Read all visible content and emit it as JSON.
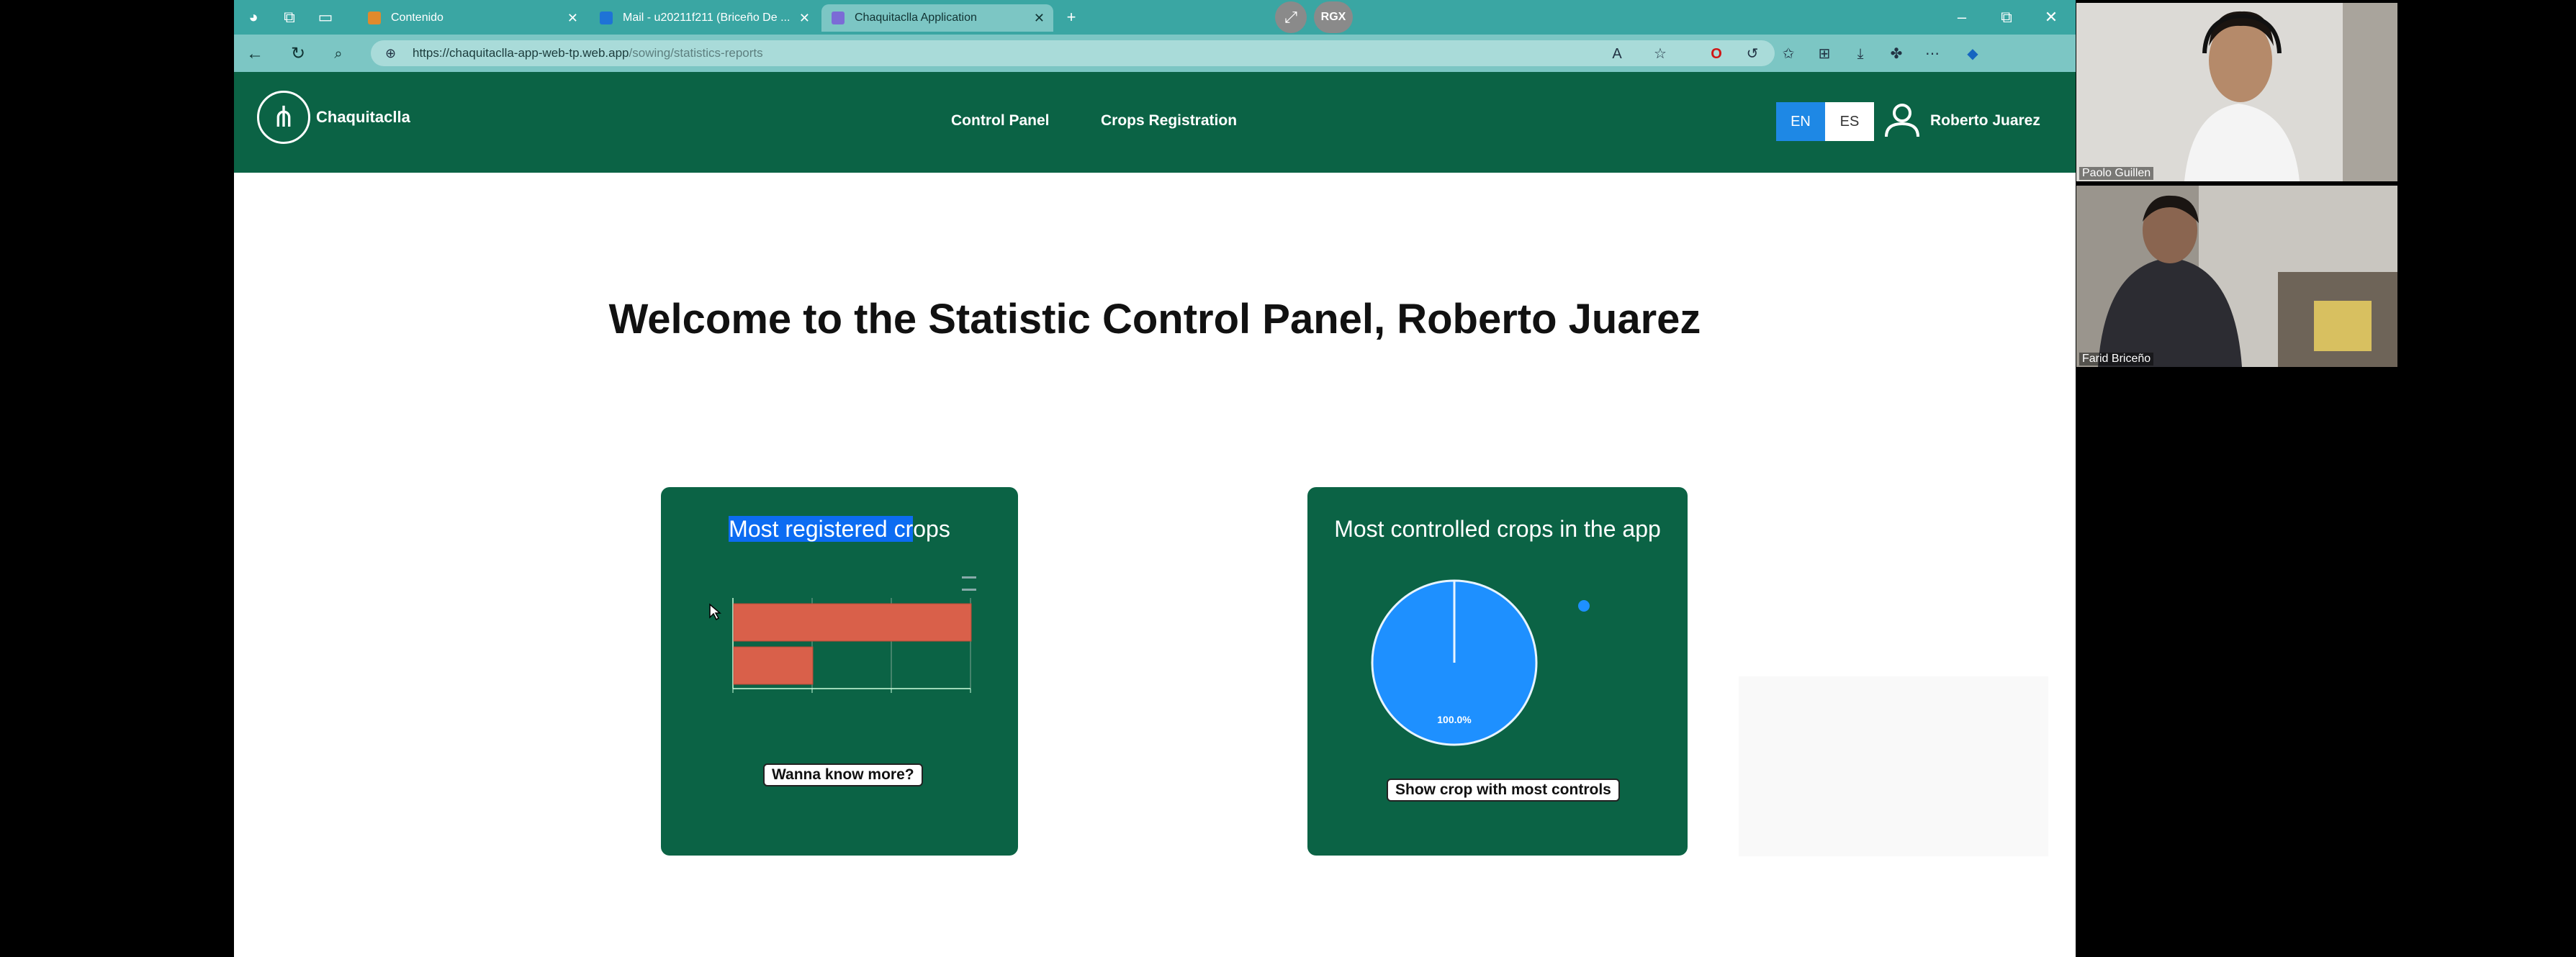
{
  "browser": {
    "tabs": [
      {
        "title": "Contenido",
        "favicon_color": "#e08a2c"
      },
      {
        "title": "Mail - u20211f211 (Briceño De ...",
        "favicon_color": "#1e73d6"
      },
      {
        "title": "Chaquitaclla Application",
        "favicon_color": "#7b6bd6"
      }
    ],
    "url_host": "https://chaquitaclla-app-web-tp.web.app",
    "url_path": "/sowing/statistics-reports",
    "overlay_badge": "RGX"
  },
  "app": {
    "brand": "Chaquitaclla",
    "nav": [
      "Control Panel",
      "Crops Registration"
    ],
    "lang_en": "EN",
    "lang_es": "ES",
    "user": "Roberto Juarez"
  },
  "welcome": "Welcome to the Statistic Control Panel, Roberto Juarez",
  "cards": {
    "registered": {
      "title_selected": "Most registered cr",
      "title_rest": "ops",
      "button": "Wanna know more?"
    },
    "controlled": {
      "title": "Most controlled crops in the app",
      "button": "Show crop with most controls"
    }
  },
  "chart_data": [
    {
      "type": "bar",
      "orientation": "horizontal",
      "title": "Most registered crops",
      "categories": [
        "",
        ""
      ],
      "values": [
        3,
        1
      ],
      "xlim": [
        0,
        3
      ],
      "bar_color": "#d9604a",
      "grid": true
    },
    {
      "type": "pie",
      "title": "Most controlled crops in the app",
      "values": [
        100
      ],
      "data_labels": [
        "100.0%"
      ],
      "colors": [
        "#1e90ff"
      ],
      "legend": "top-right"
    }
  ],
  "participants": [
    "Paolo Guillen",
    "Farid Briceño"
  ]
}
